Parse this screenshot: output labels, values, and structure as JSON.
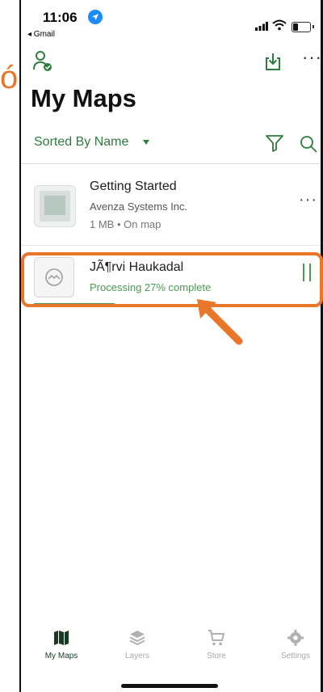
{
  "status": {
    "time": "11:06",
    "back_app": "◂ Gmail"
  },
  "header": {
    "title": "My Maps",
    "account_icon": "account-check-icon",
    "download_icon": "download-icon",
    "more_icon": "more-horizontal-icon"
  },
  "toolbar": {
    "sort_label": "Sorted By Name",
    "filter_icon": "filter-icon",
    "search_icon": "search-icon"
  },
  "maps": [
    {
      "title": "Getting Started",
      "publisher": "Avenza Systems Inc.",
      "meta": "1 MB • On map"
    },
    {
      "title": "JÃ¶rvi Haukadal",
      "status": "Processing 27% complete",
      "progress": 0.27
    }
  ],
  "tabs": [
    {
      "label": "My Maps",
      "icon": "map-icon",
      "active": true
    },
    {
      "label": "Layers",
      "icon": "layers-icon",
      "active": false
    },
    {
      "label": "Store",
      "icon": "cart-icon",
      "active": false
    },
    {
      "label": "Settings",
      "icon": "gear-icon",
      "active": false
    }
  ],
  "colors": {
    "accent": "#2e7d3e",
    "processing": "#4a9a52",
    "annotation": "#e8762b"
  }
}
